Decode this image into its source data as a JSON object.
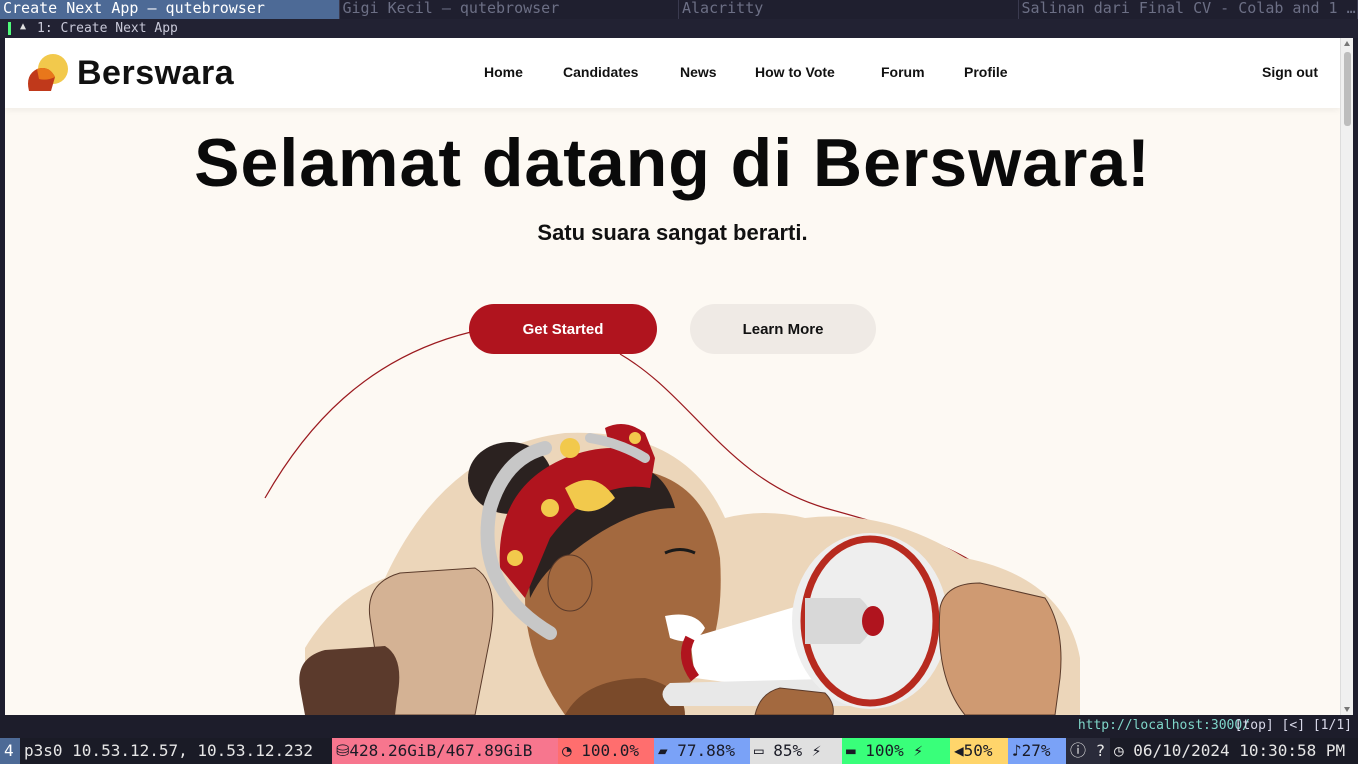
{
  "wm_tabs": [
    {
      "title": "Create Next App — qutebrowser",
      "active": true
    },
    {
      "title": "Gigi Kecil — qutebrowser",
      "active": false
    },
    {
      "title": "Alacritty",
      "active": false
    },
    {
      "title": "Salinan dari Final CV - Colab and 1 …",
      "active": false
    }
  ],
  "browser": {
    "tab_title": "1: Create Next App",
    "url": "http://localhost:3000/",
    "scroll_status": "[top] [<] [1/1]"
  },
  "site": {
    "brand": "Berswara",
    "nav": [
      "Home",
      "Candidates",
      "News",
      "How to Vote",
      "Forum",
      "Profile"
    ],
    "signout_label": "Sign out",
    "hero_title": "Selamat datang di Berswara!",
    "hero_subtitle": "Satu suara sangat berarti.",
    "cta_primary": "Get Started",
    "cta_secondary": "Learn More",
    "colors": {
      "primary": "#b0141e",
      "background": "#fdf9f3",
      "secondary_btn": "#efeae5"
    }
  },
  "statusbar": {
    "workspace": "4",
    "network": "p3s0 10.53.12.57, 10.53.12.232",
    "disk": "428.26GiB/467.89GiB",
    "cpu": "100.0%",
    "memory": "77.88%",
    "battery": "85%",
    "battery2": "100%",
    "volume": "50%",
    "mic": "27%",
    "help": "?",
    "datetime": "06/10/2024 10:30:58 PM"
  }
}
